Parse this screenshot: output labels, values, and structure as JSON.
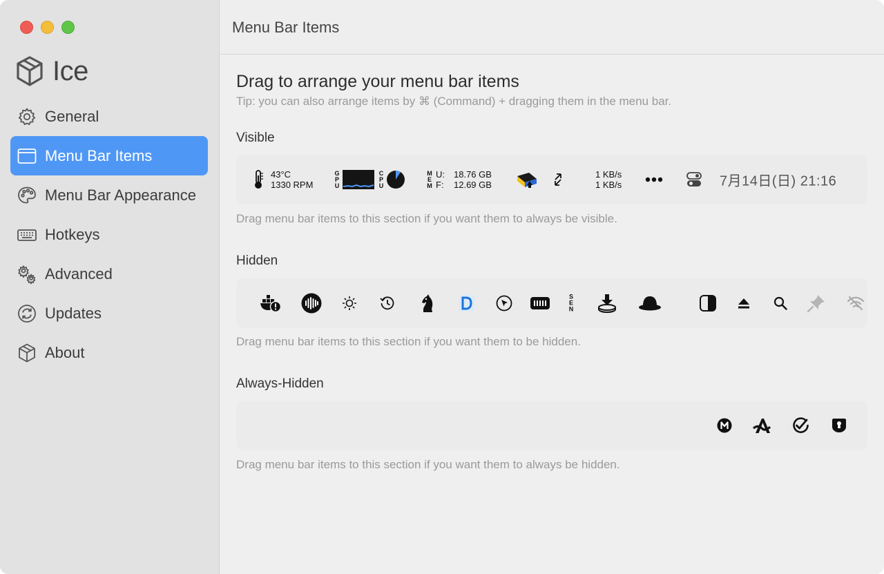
{
  "app": {
    "name": "Ice"
  },
  "header": {
    "title": "Menu Bar Items"
  },
  "sidebar": {
    "items": [
      {
        "label": "General",
        "icon": "gear-icon"
      },
      {
        "label": "Menu Bar Items",
        "icon": "window-icon",
        "active": true
      },
      {
        "label": "Menu Bar Appearance",
        "icon": "palette-icon"
      },
      {
        "label": "Hotkeys",
        "icon": "keyboard-icon"
      },
      {
        "label": "Advanced",
        "icon": "gears-icon"
      },
      {
        "label": "Updates",
        "icon": "refresh-icon"
      },
      {
        "label": "About",
        "icon": "cube-icon"
      }
    ]
  },
  "main": {
    "title": "Drag to arrange your menu bar items",
    "tip": "Tip: you can also arrange items by ⌘ (Command) + dragging them in the menu bar.",
    "sections": {
      "visible": {
        "label": "Visible",
        "hint": "Drag menu bar items to this section if you want them to always be visible.",
        "temp": "43°C",
        "rpm": "1330 RPM",
        "gpu_label": "GPU",
        "cpu_label": "CPU",
        "mem_label": "MEM",
        "mem_u": "U:",
        "mem_f": "F:",
        "mem_used": "18.76 GB",
        "mem_free": "12.69 GB",
        "net_up": "1 KB/s",
        "net_down": "1 KB/s",
        "clock": "7月14日(日)  21:16"
      },
      "hidden": {
        "label": "Hidden",
        "hint": "Drag menu bar items to this section if you want them to be hidden.",
        "sen_label": "SEN"
      },
      "always_hidden": {
        "label": "Always-Hidden",
        "hint": "Drag menu bar items to this section if you want them to always be hidden."
      }
    }
  },
  "colors": {
    "accent": "#4f97f5",
    "sidebar_bg": "#e2e2e2",
    "content_bg": "#efefef",
    "hint_text": "#9a9a9a",
    "traffic_red": "#ee5d55",
    "traffic_yellow": "#f4bd3b",
    "traffic_green": "#5fc648"
  }
}
